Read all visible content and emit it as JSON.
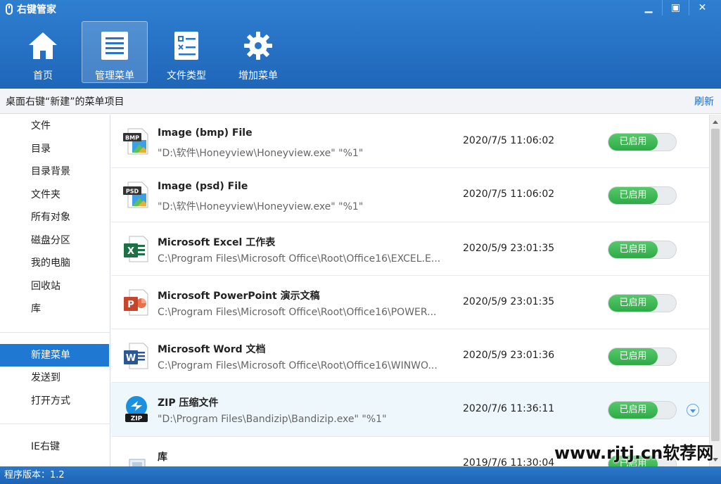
{
  "app": {
    "title": "右键管家",
    "version": "程序版本：1.2"
  },
  "window_controls": [
    "▁",
    "▣",
    "✕"
  ],
  "nav": [
    {
      "label": "首页",
      "icon": "home-icon",
      "active": false
    },
    {
      "label": "管理菜单",
      "icon": "menu-list-icon",
      "active": true
    },
    {
      "label": "文件类型",
      "icon": "file-type-icon",
      "active": false
    },
    {
      "label": "增加菜单",
      "icon": "gear-icon",
      "active": false
    }
  ],
  "subheader": {
    "title": "桌面右键“新建”的菜单项目",
    "refresh": "刷新"
  },
  "sidebar": {
    "group1": [
      "文件",
      "目录",
      "目录背景",
      "文件夹",
      "所有对象",
      "磁盘分区",
      "我的电脑",
      "回收站",
      "库"
    ],
    "group2": [
      "新建菜单",
      "发送到",
      "打开方式"
    ],
    "group3": [
      "IE右键"
    ],
    "active": "新建菜单"
  },
  "rows": [
    {
      "name": "Image (bmp) File",
      "path": "\"D:\\软件\\Honeyview\\Honeyview.exe\" \"%1\"",
      "date": "2020/7/5 11:06:02",
      "status": "已启用",
      "icon": "bmp-file-icon",
      "badge": "BMP"
    },
    {
      "name": "Image (psd) File",
      "path": "\"D:\\软件\\Honeyview\\Honeyview.exe\" \"%1\"",
      "date": "2020/7/5 11:06:02",
      "status": "已启用",
      "icon": "psd-file-icon",
      "badge": "PSD"
    },
    {
      "name": "Microsoft Excel 工作表",
      "path": "C:\\Program Files\\Microsoft Office\\Root\\Office16\\EXCEL.E...",
      "date": "2020/5/9 23:01:35",
      "status": "已启用",
      "icon": "excel-file-icon",
      "badge": "X"
    },
    {
      "name": "Microsoft PowerPoint 演示文稿",
      "path": "C:\\Program Files\\Microsoft Office\\Root\\Office16\\POWER...",
      "date": "2020/5/9 23:01:35",
      "status": "已启用",
      "icon": "powerpoint-file-icon",
      "badge": "P"
    },
    {
      "name": "Microsoft Word 文档",
      "path": "C:\\Program Files\\Microsoft Office\\Root\\Office16\\WINWO...",
      "date": "2020/5/9 23:01:36",
      "status": "已启用",
      "icon": "word-file-icon",
      "badge": "W"
    },
    {
      "name": "ZIP 压缩文件",
      "path": "\"D:\\Program Files\\Bandizip\\Bandizip.exe\" \"%1\"",
      "date": "2020/7/6 11:36:11",
      "status": "已启用",
      "icon": "zip-file-icon",
      "badge": "ZIP"
    },
    {
      "name": "库",
      "path": "",
      "date": "2019/7/6 11:30:04",
      "status": "已启用",
      "icon": "library-icon",
      "badge": ""
    }
  ],
  "watermark": "www.rjtj.cn软荐网",
  "colors": {
    "header": "#2f7fd0",
    "accent": "#1f78d1",
    "toggle_on": "#3cb554"
  }
}
